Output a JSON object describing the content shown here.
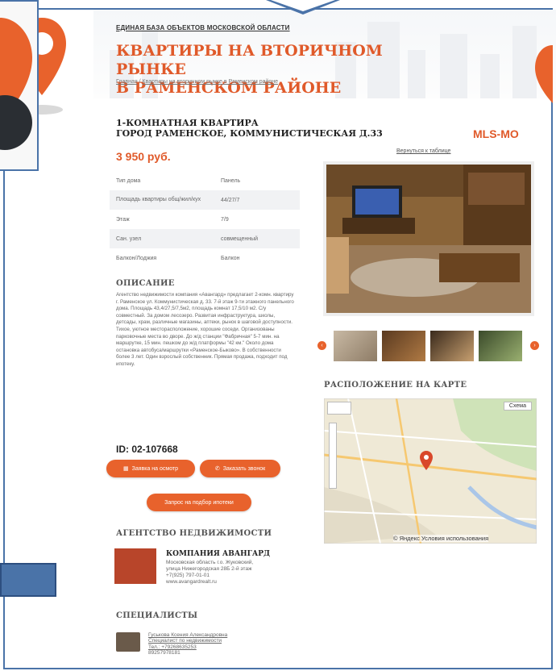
{
  "header": {
    "top_label": "ЕДИНАЯ БАЗА ОБЪЕКТОВ МОСКОВСКОЙ ОБЛАСТИ",
    "title_line1": "КВАРТИРЫ НА ВТОРИЧНОМ РЫНКЕ",
    "title_line2": "В РАМЕНСКОМ РАЙОНЕ",
    "breadcrumb_home": "Главная",
    "breadcrumb_sep": " / ",
    "breadcrumb_current": "Квартиры на вторичном рынке в Раменском районе"
  },
  "colors": {
    "accent": "#e05a2a",
    "frame": "#4a73a8"
  },
  "property": {
    "title_line1": "1-КОМНАТНАЯ КВАРТИРА",
    "title_line2": "ГОРОД РАМЕНСКОЕ, КОММУНИСТИЧЕСКАЯ Д.33",
    "price": "3 950 руб.",
    "mls": "MLS-MO",
    "back_link": "Вернуться к таблице",
    "params": [
      {
        "label": "Тип дома",
        "value": "Панель"
      },
      {
        "label": "Площадь квартиры общ/жил/кух",
        "value": "44/27/7"
      },
      {
        "label": "Этаж",
        "value": "7/9"
      },
      {
        "label": "Сан. узел",
        "value": "совмещенный"
      },
      {
        "label": "Балкон/Лоджия",
        "value": "Балкон"
      }
    ],
    "description_heading": "ОПИСАНИЕ",
    "description": "Агентство недвижимости компания «Авангард» предлагает 2-комн. квартиру г. Раменское ул. Коммунистическая д. 33. 7-й этаж 9-ти этажного панельного дома. Площадь 43,4/27,5/7,5м2, площадь комнат 17,5/10 м2. С/у совместный. За домом лесозеро. Развитая инфраструктура, школы, детсады, храм, различные магазины, аптеки, рынок в шаговой доступности. Тихое, уютное месторасположение, хорошие соседи. Организованы парковочные места во дворе. До ж/д станции \"Фабричная\" 5-7 мин. на маршрутке, 15 мин. пешком до ж/д платформы \"42 км.\" Около дома остановка автобуса/маршрутки «Раменское-Быково». В собственности более 3 лет. Один взрослый собственник. Прямая продажа, подходит под ипотеку.",
    "id_label": "ID: 02-107668"
  },
  "buttons": {
    "viewing": "Заявка на осмотр",
    "callback": "Заказать звонок",
    "mortgage": "Запрос на подбор ипотеки"
  },
  "map": {
    "heading": "РАСПОЛОЖЕНИЕ НА КАРТЕ",
    "scheme_label": "Схема",
    "copyright": "© Яндекс Условия использования"
  },
  "agency": {
    "heading": "АГЕНТСТВО НЕДВИЖИМОСТИ",
    "name": "КОМПАНИЯ АВАНГАРД",
    "address_line1": "Московская область г.о. Жуковский,",
    "address_line2": "улица Нижегородская 28Б 2-й этаж",
    "phone": "+7(925) 797-01-01",
    "site": "www.avangardrealt.ru"
  },
  "specialists": {
    "heading": "СПЕЦИАЛИСТЫ",
    "name": "Гуськова Ксения Александровна",
    "role": "Специалист по недвижимости",
    "phone1": "Тел.: +79268635253",
    "phone2": "89257978181"
  }
}
